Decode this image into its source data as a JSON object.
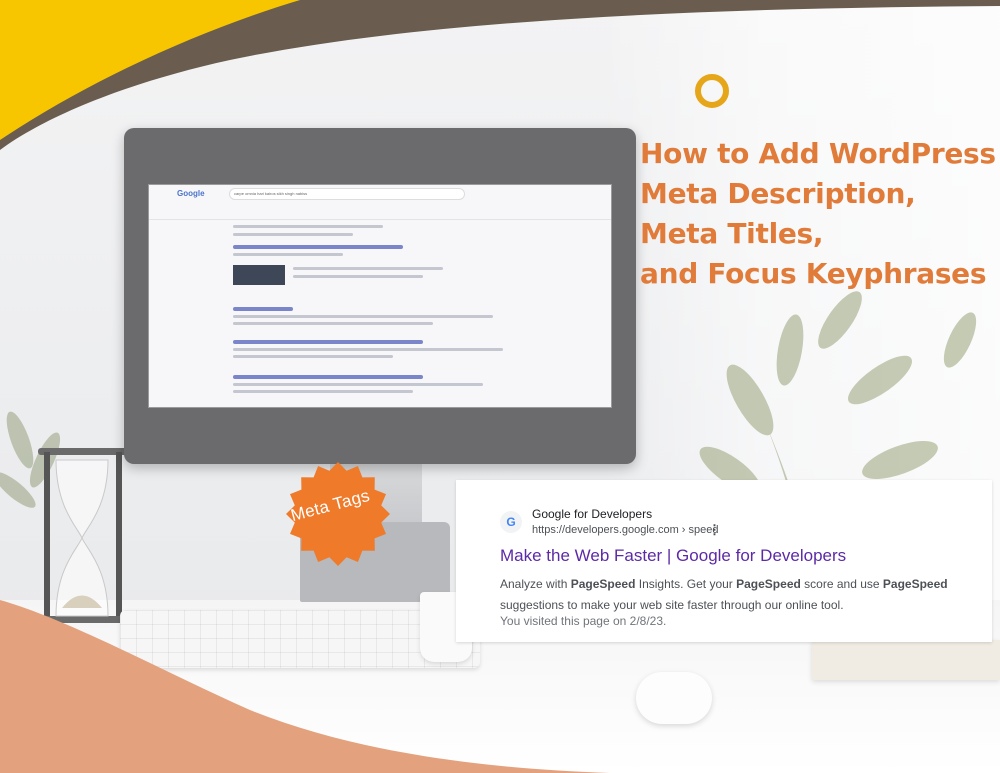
{
  "title": {
    "lines": [
      "How to Add WordPress",
      "Meta Description,",
      "Meta Titles,",
      "and Focus Keyphrases"
    ]
  },
  "badge": {
    "text": "Meta Tags"
  },
  "screen": {
    "logo": "Google",
    "query": "carpe omnia hari kairos sikh singh nabiss"
  },
  "search_result": {
    "favicon": "G",
    "site_name": "Google for Developers",
    "url": "https://developers.google.com › speed",
    "more_icon": "⋮",
    "link_text": "Make the Web Faster | Google for Developers",
    "snippet": {
      "p1": "Analyze with ",
      "b1": "PageSpeed",
      "p2": " Insights. Get your ",
      "b2": "PageSpeed",
      "p3": " score and use ",
      "b3": "PageSpeed",
      "p4": " suggestions to make your web site faster through our online tool."
    },
    "visited": "You visited this page on 2/8/23."
  },
  "colors": {
    "accent_orange": "#e07b39",
    "badge_orange": "#ef7a2a",
    "yellow": "#f7c600",
    "dark_band": "#6a5d4f",
    "salmon": "#e3a27d",
    "link_purple": "#5c2aa6"
  }
}
